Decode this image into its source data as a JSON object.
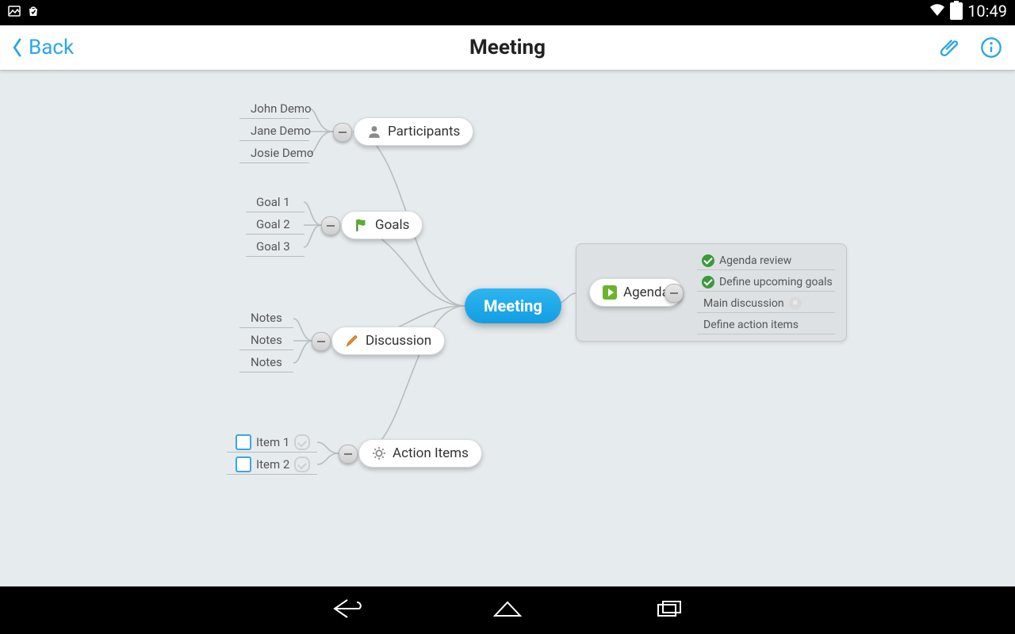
{
  "statusbar": {
    "time": "10:49"
  },
  "header": {
    "back": "Back",
    "title": "Meeting"
  },
  "root": {
    "label": "Meeting"
  },
  "participants": {
    "label": "Participants",
    "children": [
      "John Demo",
      "Jane Demo",
      "Josie Demo"
    ]
  },
  "goals": {
    "label": "Goals",
    "children": [
      "Goal 1",
      "Goal 2",
      "Goal 3"
    ]
  },
  "discussion": {
    "label": "Discussion",
    "children": [
      "Notes",
      "Notes",
      "Notes"
    ]
  },
  "action_items": {
    "label": "Action Items",
    "children": [
      "Item 1",
      "Item 2"
    ]
  },
  "agenda": {
    "label": "Agenda",
    "children": [
      "Agenda review",
      "Define upcoming goals",
      "Main discussion",
      "Define action items"
    ]
  }
}
